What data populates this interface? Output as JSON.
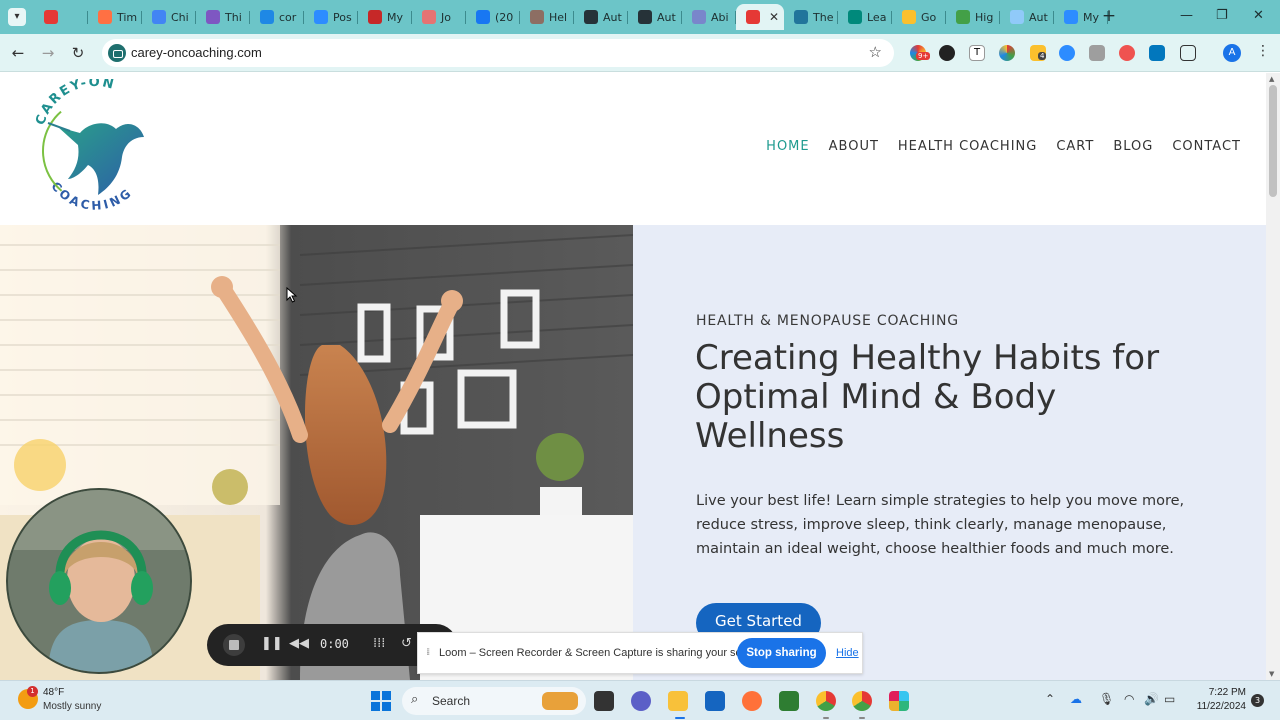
{
  "browser": {
    "tabs": [
      {
        "label": "",
        "color": "#e53935"
      },
      {
        "label": "Tim",
        "color": "#ff7043"
      },
      {
        "label": "Chi",
        "color": "#4285f4"
      },
      {
        "label": "Thi",
        "color": "#7e57c2"
      },
      {
        "label": "cor",
        "color": "#1e88e5"
      },
      {
        "label": "Pos",
        "color": "#2d8cff"
      },
      {
        "label": "My",
        "color": "#c62828"
      },
      {
        "label": "Jo",
        "color": "#e57373"
      },
      {
        "label": "(20",
        "color": "#1877f2"
      },
      {
        "label": "Hel",
        "color": "#8d6e63"
      },
      {
        "label": "Aut",
        "color": "#263238"
      },
      {
        "label": "Aut",
        "color": "#263238"
      },
      {
        "label": "Abi",
        "color": "#7986cb"
      },
      {
        "label": "",
        "color": "#e53935",
        "active": true
      },
      {
        "label": "The",
        "color": "#21759b"
      },
      {
        "label": "Lea",
        "color": "#00897b"
      },
      {
        "label": "Go",
        "color": "#fbc02d"
      },
      {
        "label": "Hig",
        "color": "#43a047"
      },
      {
        "label": "Aut",
        "color": "#90caf9"
      },
      {
        "label": "My",
        "color": "#2d8cff"
      }
    ],
    "url": "carey-oncoaching.com",
    "profile_initial": "A",
    "extension_badge": "4",
    "extension_badge_2": "9+"
  },
  "site": {
    "logo": {
      "top_text": "CAREY-ON",
      "bottom_text": "COACHING"
    },
    "nav": [
      {
        "label": "HOME",
        "active": true
      },
      {
        "label": "ABOUT"
      },
      {
        "label": "HEALTH COACHING"
      },
      {
        "label": "CART"
      },
      {
        "label": "BLOG"
      },
      {
        "label": "CONTACT"
      }
    ],
    "hero": {
      "eyebrow": "HEALTH & MENOPAUSE COACHING",
      "title": "Creating Healthy Habits for Optimal Mind & Body Wellness",
      "body": "Live your best life! Learn simple strategies to help you move more, reduce stress, improve sleep, think clearly, manage menopause, maintain an ideal weight, choose healthier foods and much more.",
      "cta": "Get Started"
    },
    "colors": {
      "accent": "#1e9b8f",
      "cta": "#1565c0",
      "hero_bg": "#e7ecf7"
    }
  },
  "loom": {
    "timer": "0:00",
    "share_message": "Loom – Screen Recorder & Screen Capture is sharing your screen.",
    "stop_label": "Stop sharing",
    "hide_label": "Hide"
  },
  "taskbar": {
    "weather_temp": "48°F",
    "weather_desc": "Mostly sunny",
    "weather_badge": "1",
    "search_label": "Search",
    "time": "7:22 PM",
    "date": "11/22/2024",
    "notifications": "3"
  }
}
